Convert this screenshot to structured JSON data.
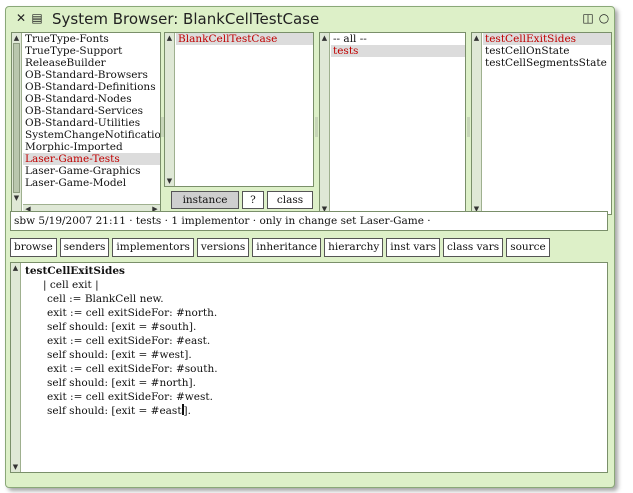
{
  "window": {
    "title": "System Browser: BlankCellTestCase",
    "close_icon": "✕",
    "menu_icon": "▤",
    "collapse_icon": "◫",
    "expand_icon": "○"
  },
  "packages": {
    "items": [
      {
        "label": "TrueType-Fonts"
      },
      {
        "label": "TrueType-Support"
      },
      {
        "label": "ReleaseBuilder"
      },
      {
        "label": "OB-Standard-Browsers"
      },
      {
        "label": "OB-Standard-Definitions"
      },
      {
        "label": "OB-Standard-Nodes"
      },
      {
        "label": "OB-Standard-Services"
      },
      {
        "label": "OB-Standard-Utilities"
      },
      {
        "label": "SystemChangeNotification"
      },
      {
        "label": "Morphic-Imported"
      },
      {
        "label": "Laser-Game-Tests"
      },
      {
        "label": "Laser-Game-Graphics"
      },
      {
        "label": "Laser-Game-Model"
      }
    ],
    "selected_index": 10
  },
  "classes": {
    "items": [
      {
        "label": "BlankCellTestCase"
      }
    ],
    "selected_index": 0
  },
  "categories": {
    "items": [
      {
        "label": "-- all --"
      },
      {
        "label": "tests"
      }
    ],
    "selected_index": 1
  },
  "methods": {
    "items": [
      {
        "label": "testCellExitSides"
      },
      {
        "label": "testCellOnState"
      },
      {
        "label": "testCellSegmentsState"
      }
    ],
    "selected_index": 0
  },
  "class_side_buttons": {
    "instance": "instance",
    "help": "?",
    "class": "class"
  },
  "info_line": "sbw 5/19/2007 21:11 · tests · 1 implementor · only in change set Laser-Game  ·",
  "toolbar": {
    "browse": "browse",
    "senders": "senders",
    "implementors": "implementors",
    "versions": "versions",
    "inheritance": "inheritance",
    "hierarchy": "hierarchy",
    "inst_vars": "inst vars",
    "class_vars": "class vars",
    "source": "source"
  },
  "code": {
    "signature": "testCellExitSides",
    "lines": [
      "| cell exit |",
      "cell := BlankCell new.",
      "exit := cell exitSideFor: #north.",
      "self should: [exit = #south].",
      "exit := cell exitSideFor: #east.",
      "self should: [exit = #west].",
      "exit := cell exitSideFor: #south.",
      "self should: [exit = #north].",
      "exit := cell exitSideFor: #west."
    ],
    "last_line_before_caret": "self should: [exit = #east",
    "last_line_after_caret": "]."
  }
}
